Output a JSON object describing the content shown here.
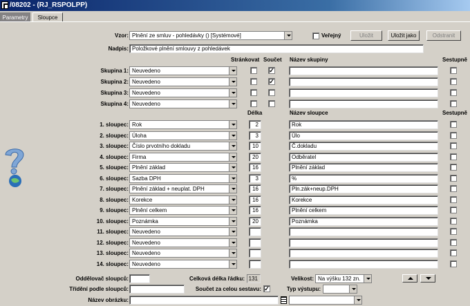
{
  "window": {
    "title": "/08202 - (RJ_RSPOLPP)"
  },
  "tabs": [
    {
      "label": "Parametry"
    },
    {
      "label": "Sloupce"
    }
  ],
  "top": {
    "vzor_label": "Vzor:",
    "vzor_value": "Plnění ze smluv - pohledávky   ()   [Systémové]",
    "verejny_label": "Veřejný",
    "verejny_checked": false,
    "ulozit_label": "Uložit",
    "ulozit_jako_label": "Uložit jako",
    "odstranit_label": "Odstranit",
    "nadpis_label": "Nadpis:",
    "nadpis_value": "Položkové plnění smlouvy z pohledávek"
  },
  "groups_header": {
    "strankovat": "Stránkovat",
    "soucet": "Součet",
    "nazev_skupiny": "Název skupiny",
    "sestupne": "Sestupně"
  },
  "groups": [
    {
      "label": "Skupina 1:",
      "value": "Neuvedeno",
      "strankovat": false,
      "soucet": true
    },
    {
      "label": "Skupina 2:",
      "value": "Neuvedeno",
      "strankovat": false,
      "soucet": true
    },
    {
      "label": "Skupina 3:",
      "value": "Neuvedeno",
      "strankovat": false,
      "soucet": false
    },
    {
      "label": "Skupina 4:",
      "value": "Neuvedeno",
      "strankovat": false,
      "soucet": false
    }
  ],
  "columns_header": {
    "delka": "Délka",
    "nazev_sloupce": "Název sloupce",
    "sestupne": "Sestupně"
  },
  "columns": [
    {
      "label": "1. sloupec:",
      "value": "Rok",
      "length": "2",
      "name": "Rok"
    },
    {
      "label": "2. sloupec:",
      "value": "Úloha",
      "length": "3",
      "name": "Úlo"
    },
    {
      "label": "3. sloupec:",
      "value": "Číslo prvotního dokladu",
      "length": "10",
      "name": "Č.dokladu"
    },
    {
      "label": "4. sloupec:",
      "value": "Firma",
      "length": "20",
      "name": "Odběratel"
    },
    {
      "label": "5. sloupec:",
      "value": "Plnění základ",
      "length": "16",
      "name": "Plnění základ"
    },
    {
      "label": "6. sloupec:",
      "value": "Sazba DPH",
      "length": "3",
      "name": "%"
    },
    {
      "label": "7. sloupec:",
      "value": "Plnění základ + neuplat. DPH",
      "length": "16",
      "name": "Pln.zák+neup.DPH"
    },
    {
      "label": "8. sloupec:",
      "value": "Korekce",
      "length": "16",
      "name": "Korekce"
    },
    {
      "label": "9. sloupec:",
      "value": "Plnění celkem",
      "length": "16",
      "name": "Plnění celkem"
    },
    {
      "label": "10. sloupec:",
      "value": "Poznámka",
      "length": "20",
      "name": "Poznámka"
    },
    {
      "label": "11. sloupec:",
      "value": "Neuvedeno",
      "length": "",
      "name": ""
    },
    {
      "label": "12. sloupec:",
      "value": "Neuvedeno",
      "length": "",
      "name": ""
    },
    {
      "label": "13. sloupec:",
      "value": "Neuvedeno",
      "length": "",
      "name": ""
    },
    {
      "label": "14. sloupec:",
      "value": "Neuvedeno",
      "length": "",
      "name": ""
    }
  ],
  "footer": {
    "oddelovac_label": "Oddělovač sloupců:",
    "celkova_delka_label": "Celková délka řádku:",
    "celkova_delka_value": "131",
    "velikost_label": "Velikost:",
    "velikost_value": "Na výšku 132 zn.",
    "trideni_label": "Třídění podle sloupců:",
    "soucet_label": "Součet za celou sestavu:",
    "soucet_checked": true,
    "typ_vystupu_label": "Typ výstupu:",
    "nazev_obrazku_label": "Název obrázku:"
  }
}
